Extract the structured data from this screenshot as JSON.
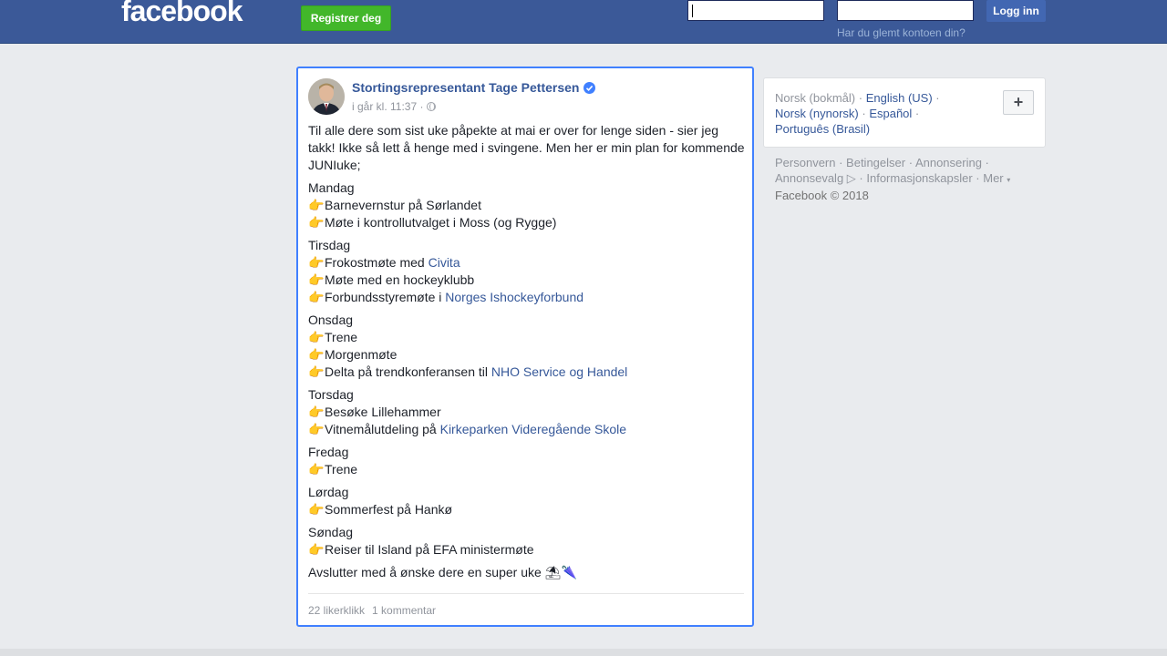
{
  "header": {
    "logo": "facebook",
    "register_label": "Registrer deg",
    "login_label": "Logg inn",
    "forgot_label": "Har du glemt kontoen din?"
  },
  "post": {
    "author": "Stortingsrepresentant Tage Pettersen",
    "timestamp": "i går kl. 11:37 ·",
    "intro": "Til alle dere som sist uke påpekte at mai er over for lenge siden - sier jeg takk! Ikke så lett å henge med i svingene. Men her er min plan for kommende JUNIuke;",
    "days": [
      {
        "day": "Mandag",
        "items": [
          {
            "text": "Barnevernstur på Sørlandet",
            "link": ""
          },
          {
            "text": "Møte i kontrollutvalget i Moss (og Rygge)",
            "link": ""
          }
        ]
      },
      {
        "day": "Tirsdag",
        "items": [
          {
            "text": "Frokostmøte med ",
            "link": "Civita"
          },
          {
            "text": "Møte med en hockeyklubb",
            "link": ""
          },
          {
            "text": "Forbundsstyremøte i ",
            "link": "Norges Ishockeyforbund"
          }
        ]
      },
      {
        "day": "Onsdag",
        "items": [
          {
            "text": "Trene",
            "link": ""
          },
          {
            "text": "Morgenmøte",
            "link": ""
          },
          {
            "text": "Delta på trendkonferansen til ",
            "link": "NHO Service og Handel"
          }
        ]
      },
      {
        "day": "Torsdag",
        "items": [
          {
            "text": "Besøke Lillehammer",
            "link": ""
          },
          {
            "text": "Vitnemålutdeling på ",
            "link": "Kirkeparken Videregående Skole"
          }
        ]
      },
      {
        "day": "Fredag",
        "items": [
          {
            "text": "Trene",
            "link": ""
          }
        ]
      },
      {
        "day": "Lørdag",
        "items": [
          {
            "text": "Sommerfest på Hankø",
            "link": ""
          }
        ]
      },
      {
        "day": "Søndag",
        "items": [
          {
            "text": "Reiser til Island på EFA ministermøte",
            "link": ""
          }
        ]
      }
    ],
    "closing": "Avslutter med å ønske dere en super uke",
    "likes": "22 likerklikk",
    "comments": "1 kommentar"
  },
  "languages": {
    "current": "Norsk (bokmål) ·",
    "options": [
      "English (US)",
      "Norsk (nynorsk)",
      "Español",
      "Português (Brasil)"
    ]
  },
  "footer": {
    "links": [
      "Personvern",
      "Betingelser",
      "Annonsering",
      "Annonsevalg",
      "Informasjonskapsler",
      "Mer"
    ],
    "copyright": "Facebook © 2018"
  },
  "icons": {
    "point": "backhand-index-pointing-right",
    "verified": "verified-badge",
    "globe": "globe",
    "umbrella": "umbrella"
  },
  "colors": {
    "brand": "#3b5998",
    "register": "#42b72a",
    "link": "#365899"
  }
}
